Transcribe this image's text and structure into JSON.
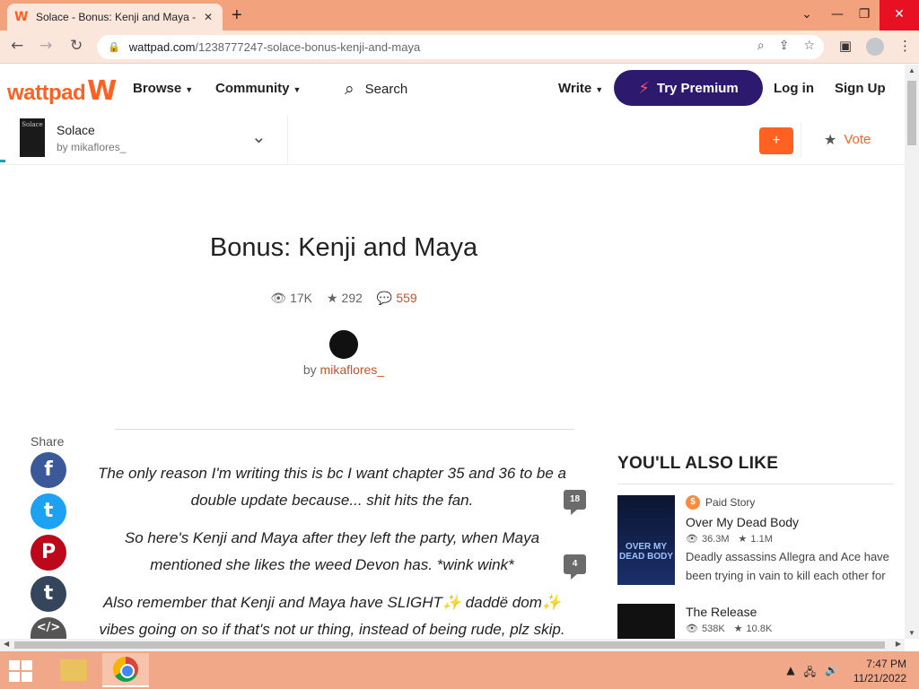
{
  "browser": {
    "tab_title": "Solace - Bonus: Kenji and Maya -",
    "tab_close": "✕",
    "new_tab": "+",
    "url_domain": "wattpad.com",
    "url_path": "/1238777247-solace-bonus-kenji-and-maya"
  },
  "header": {
    "logo": "wattpad",
    "browse": "Browse",
    "community": "Community",
    "search": "Search",
    "write": "Write",
    "premium": "Try Premium",
    "login": "Log in",
    "signup": "Sign Up"
  },
  "story": {
    "title": "Solace",
    "author": "by mikaflores_",
    "cover_text": "Solace",
    "add_label": "+",
    "vote_label": "Vote"
  },
  "chapter": {
    "title": "Bonus: Kenji and Maya",
    "reads": "17K",
    "votes": "292",
    "comments": "559",
    "by": "by",
    "author": "mikaflores_"
  },
  "share": {
    "label": "Share",
    "items": [
      {
        "name": "facebook",
        "glyph": "f",
        "color": "#3b5998"
      },
      {
        "name": "twitter",
        "glyph": "t",
        "color": "#1da1f2"
      },
      {
        "name": "pinterest",
        "glyph": "P",
        "color": "#bd081c"
      },
      {
        "name": "tumblr",
        "glyph": "t",
        "color": "#35465c"
      },
      {
        "name": "embed",
        "glyph": "</>",
        "color": "#555555"
      }
    ]
  },
  "paragraphs": [
    {
      "text": "The only reason I'm writing this is bc I want chapter 35 and 36 to be a double update because... shit hits the fan.",
      "comments": "18"
    },
    {
      "text": "So here's Kenji and Maya after they left the party, when Maya mentioned she likes the weed Devon has. *wink wink*",
      "comments": "4"
    },
    {
      "text": "Also remember that Kenji and Maya have SLIGHT✨ daddë dom✨ vibes going on so if that's not ur thing, instead of being rude, plz skip.",
      "comments": ""
    }
  ],
  "also_like": {
    "heading": "YOU'LL ALSO LIKE",
    "items": [
      {
        "paid": "Paid Story",
        "title": "Over My Dead Body",
        "reads": "36.3M",
        "votes": "1.1M",
        "desc": "Deadly assassins Allegra and Ace have been trying in vain to kill each other for",
        "cover_text": "OVER MY DEAD BODY"
      },
      {
        "paid": "",
        "title": "The Release",
        "reads": "538K",
        "votes": "10.8K",
        "desc": "",
        "cover_text": ""
      }
    ]
  },
  "taskbar": {
    "time": "7:47 PM",
    "date": "11/21/2022"
  }
}
